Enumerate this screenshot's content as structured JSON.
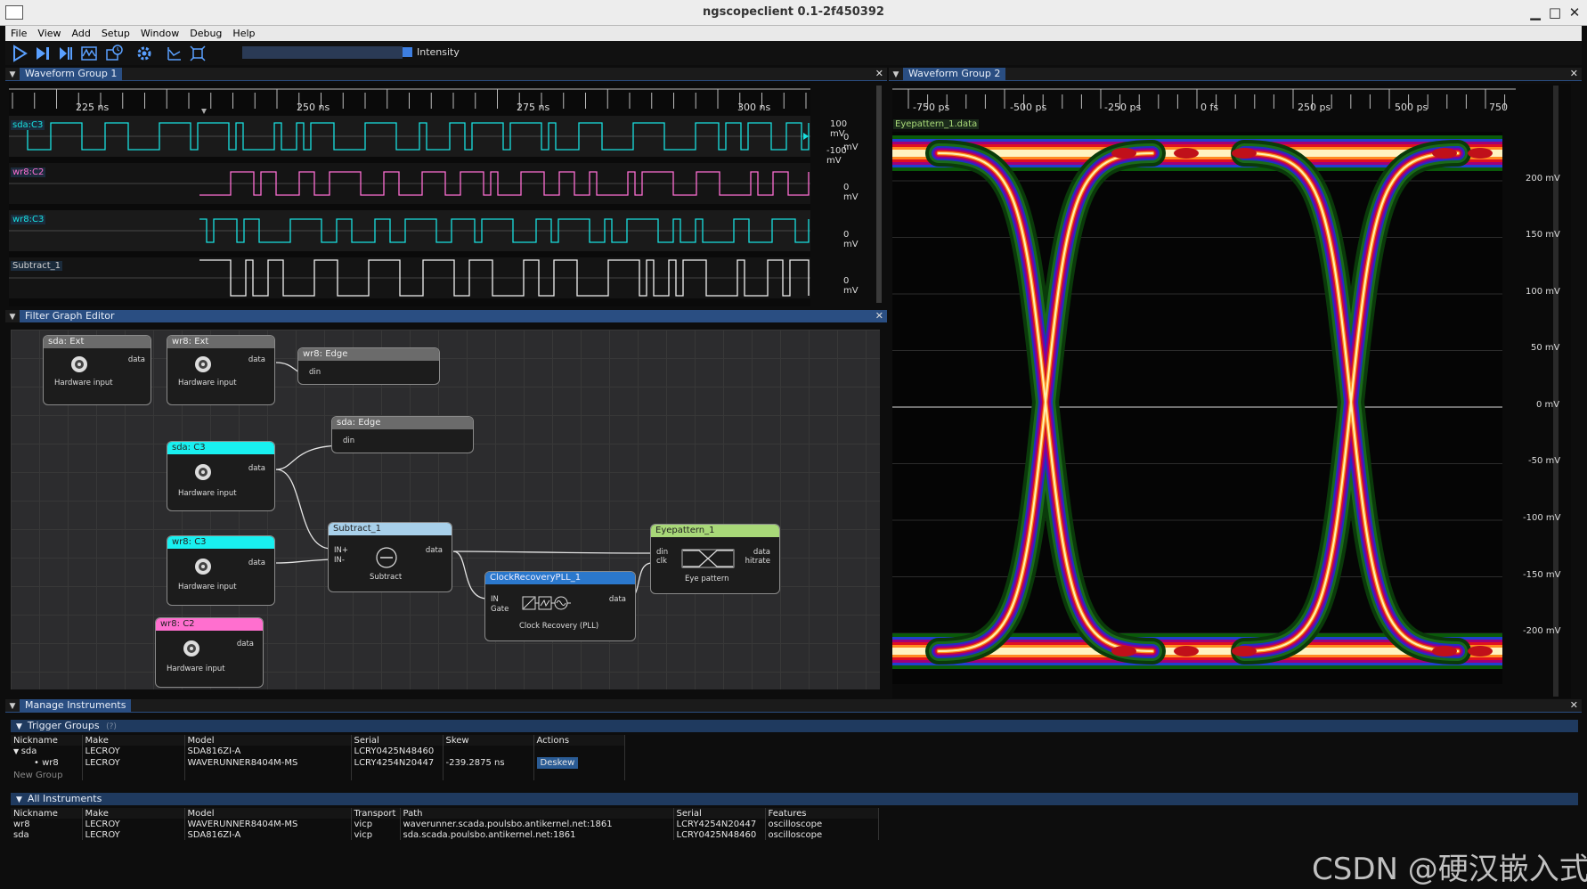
{
  "window": {
    "title": "ngscopeclient 0.1-2f450392",
    "minimize": "▁",
    "maximize": "□",
    "close": "✕"
  },
  "menu": [
    "File",
    "View",
    "Add",
    "Setup",
    "Window",
    "Debug",
    "Help"
  ],
  "toolbar": {
    "icons": [
      "run-icon",
      "single-icon",
      "force-icon",
      "waveform-icon",
      "history-icon",
      "settings-icon",
      "measure-icon",
      "fullscreen-icon"
    ],
    "intensity_label": "Intensity"
  },
  "wfg1": {
    "tab": "Waveform Group 1",
    "close": "✕",
    "time_labels": [
      "225 ns",
      "250 ns",
      "275 ns",
      "300 ns"
    ],
    "channels": [
      {
        "name": "sda:C3",
        "color": "#19e0e0",
        "scale": [
          "100 mV",
          "0 mV",
          "-100 mV"
        ]
      },
      {
        "name": "wr8:C2",
        "color": "#ff6fd4",
        "scale": [
          "0 mV"
        ]
      },
      {
        "name": "wr8:C3",
        "color": "#19e0e0",
        "scale": [
          "0 mV"
        ]
      },
      {
        "name": "Subtract_1",
        "color": "#f0f0f0",
        "scale": [
          "0 mV"
        ]
      }
    ]
  },
  "fge": {
    "tab": "Filter Graph Editor",
    "close": "✕",
    "nodes": {
      "sda_ext": {
        "title": "sda: Ext",
        "sub": "Hardware input",
        "out": "data"
      },
      "wr8_ext": {
        "title": "wr8: Ext",
        "sub": "Hardware input",
        "out": "data"
      },
      "wr8_edge": {
        "title": "wr8: Edge",
        "in": "din"
      },
      "sda_edge": {
        "title": "sda: Edge",
        "in": "din"
      },
      "sda_c3": {
        "title": "sda: C3",
        "sub": "Hardware input",
        "out": "data",
        "color": "#19f0f0"
      },
      "wr8_c3": {
        "title": "wr8: C3",
        "sub": "Hardware input",
        "out": "data",
        "color": "#19f0f0"
      },
      "wr8_c2": {
        "title": "wr8: C2",
        "sub": "Hardware input",
        "out": "data",
        "color": "#ff6fcf"
      },
      "subtract": {
        "title": "Subtract_1",
        "sub": "Subtract",
        "in1": "IN+",
        "in2": "IN-",
        "out": "data",
        "color": "#a8d0ea"
      },
      "eye": {
        "title": "Eyepattern_1",
        "sub": "Eye pattern",
        "in1": "din",
        "in2": "clk",
        "out1": "data",
        "out2": "hitrate",
        "color": "#a8d878"
      },
      "cdr": {
        "title": "ClockRecoveryPLL_1",
        "sub": "Clock Recovery (PLL)",
        "in1": "IN",
        "in2": "Gate",
        "out": "data",
        "color": "#2b78cc"
      }
    }
  },
  "wfg2": {
    "tab": "Waveform Group 2",
    "close": "✕",
    "time_labels": [
      "-750 ps",
      "-500 ps",
      "-250 ps",
      "0 fs",
      "250 ps",
      "500 ps",
      "750"
    ],
    "channel": "Eyepattern_1.data",
    "scale": [
      "200 mV",
      "150 mV",
      "100 mV",
      "50 mV",
      "0 mV",
      "-50 mV",
      "-100 mV",
      "-150 mV",
      "-200 mV"
    ]
  },
  "manage": {
    "tab": "Manage Instruments",
    "close": "✕",
    "trigger_groups": {
      "label": "Trigger Groups",
      "help": "(?)",
      "headers": [
        "Nickname",
        "Make",
        "Model",
        "Serial",
        "Skew",
        "Actions"
      ],
      "rows": [
        {
          "nickname": "sda",
          "make": "LECROY",
          "model": "SDA816ZI-A",
          "serial": "LCRY0425N48460",
          "skew": "",
          "action": ""
        },
        {
          "nickname": "wr8",
          "make": "LECROY",
          "model": "WAVERUNNER8404M-MS",
          "serial": "LCRY4254N20447",
          "skew": "-239.2875 ns",
          "action": "Deskew"
        }
      ],
      "new_group": "New Group"
    },
    "all_instruments": {
      "label": "All Instruments",
      "headers": [
        "Nickname",
        "Make",
        "Model",
        "Transport",
        "Path",
        "Serial",
        "Features"
      ],
      "rows": [
        {
          "nickname": "wr8",
          "make": "LECROY",
          "model": "WAVERUNNER8404M-MS",
          "transport": "vicp",
          "path": "waverunner.scada.poulsbo.antikernel.net:1861",
          "serial": "LCRY4254N20447",
          "features": "oscilloscope"
        },
        {
          "nickname": "sda",
          "make": "LECROY",
          "model": "SDA816ZI-A",
          "transport": "vicp",
          "path": "sda.scada.poulsbo.antikernel.net:1861",
          "serial": "LCRY0425N48460",
          "features": "oscilloscope"
        }
      ]
    }
  },
  "watermark": "CSDN @硬汉嵌入式"
}
